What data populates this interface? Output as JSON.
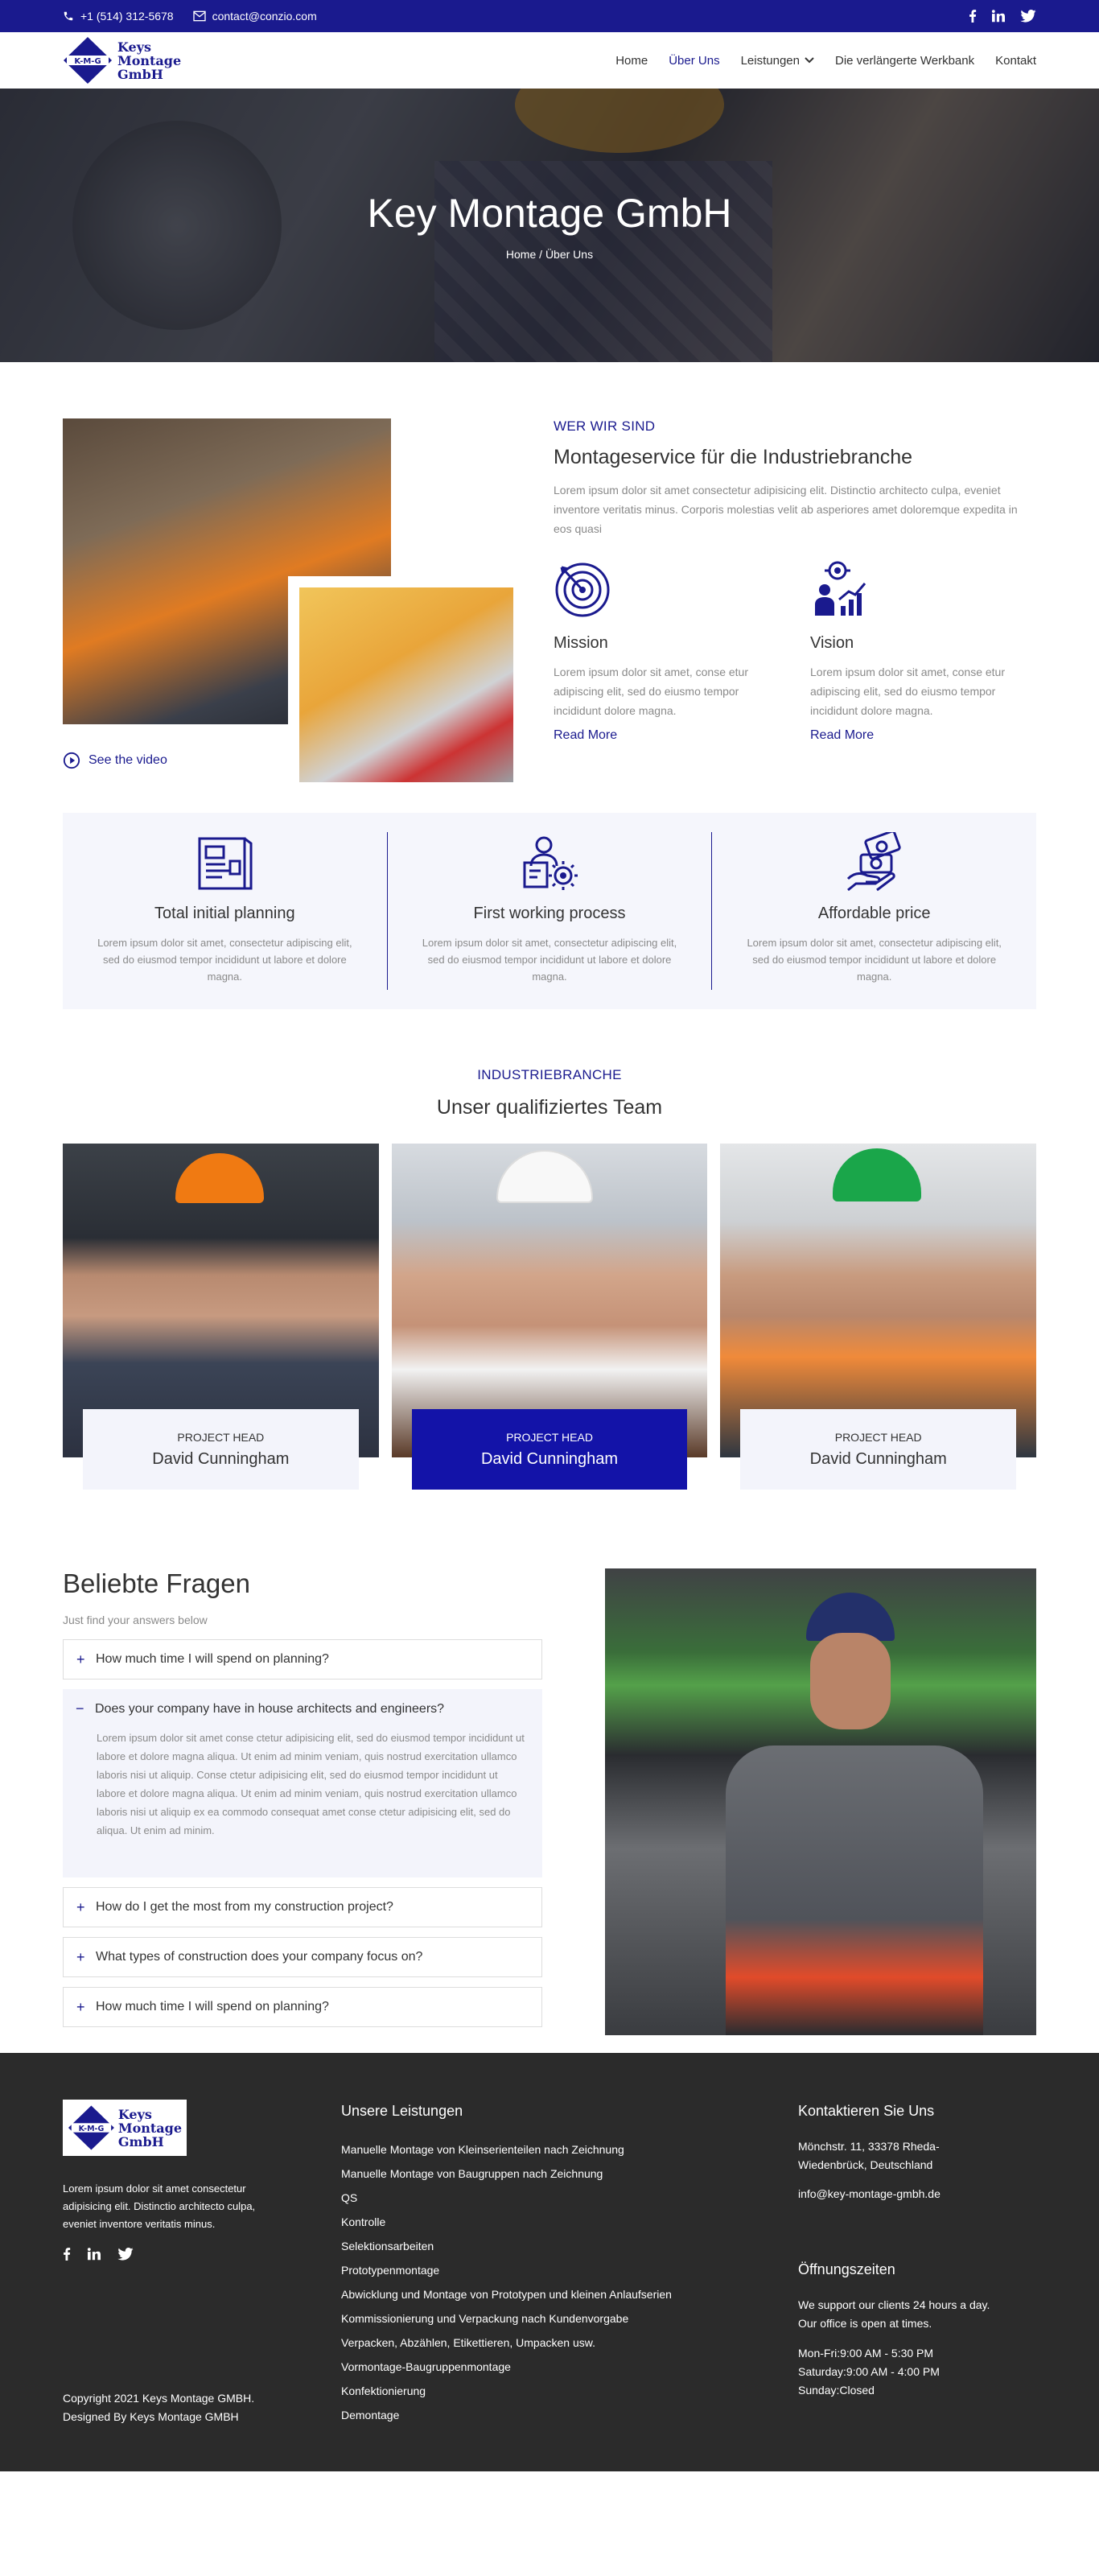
{
  "topbar": {
    "phone": "+1 (514) 312-5678",
    "email": "contact@conzio.com"
  },
  "brand": {
    "line1": "Keys",
    "line2": "Montage",
    "line3": "GmbH",
    "badge": "K-M-G"
  },
  "nav": {
    "home": "Home",
    "about": "Über Uns",
    "services": "Leistungen",
    "workbench": "Die verlängerte Werkbank",
    "contact": "Kontakt"
  },
  "hero": {
    "title": "Key Montage GmbH",
    "crumb_home": "Home",
    "crumb_sep": "/",
    "crumb_current": "Über Uns"
  },
  "about": {
    "video_label": "See the video",
    "eyebrow": "WER WIR SIND",
    "title": "Montageservice für die Industriebranche",
    "text": "Lorem ipsum dolor sit amet consectetur adipisicing elit. Distinctio architecto culpa, eveniet inventore veritatis minus. Corporis molestias velit ab asperiores amet doloremque expedita in eos quasi",
    "mission": {
      "title": "Mission",
      "text": "Lorem ipsum dolor sit amet, conse etur adipiscing elit, sed do eiusmo tempor incididunt dolore magna.",
      "link": "Read More"
    },
    "vision": {
      "title": "Vision",
      "text": "Lorem ipsum dolor sit amet, conse etur adipiscing elit, sed do eiusmo tempor incididunt dolore magna.",
      "link": "Read More"
    }
  },
  "features": [
    {
      "title": "Total initial planning",
      "text": "Lorem ipsum dolor sit amet, consectetur adipiscing elit, sed do eiusmod tempor incididunt ut labore et dolore magna."
    },
    {
      "title": "First working process",
      "text": "Lorem ipsum dolor sit amet, consectetur adipiscing elit, sed do eiusmod tempor incididunt ut labore et dolore magna."
    },
    {
      "title": "Affordable price",
      "text": "Lorem ipsum dolor sit amet, consectetur adipiscing elit, sed do eiusmod tempor incididunt ut labore et dolore magna."
    }
  ],
  "team": {
    "eyebrow": "INDUSTRIEBRANCHE",
    "title": "Unser qualifiziertes Team",
    "members": [
      {
        "role": "PROJECT HEAD",
        "name": "David Cunningham"
      },
      {
        "role": "PROJECT HEAD",
        "name": "David Cunningham"
      },
      {
        "role": "PROJECT HEAD",
        "name": "David Cunningham"
      }
    ]
  },
  "faq": {
    "title": "Beliebte Fragen",
    "subtitle": "Just find your answers below",
    "items": [
      {
        "q": "How much time I will spend on planning?",
        "sign": "+"
      },
      {
        "q": "Does your company have in house architects and engineers?",
        "sign": "−",
        "a": "Lorem ipsum dolor sit amet conse ctetur adipisicing elit, sed do eiusmod tempor incididunt ut labore et dolore magna aliqua. Ut enim ad minim veniam, quis nostrud exercitation ullamco laboris nisi ut aliquip. Conse ctetur adipisicing elit, sed do eiusmod tempor incididunt ut labore et dolore magna aliqua. Ut enim ad minim veniam, quis nostrud exercitation ullamco laboris nisi ut aliquip ex ea commodo consequat amet conse ctetur adipisicing elit, sed do aliqua. Ut enim ad minim."
      },
      {
        "q": "How do I get the most from my construction project?",
        "sign": "+"
      },
      {
        "q": "What types of construction does your company focus on?",
        "sign": "+"
      },
      {
        "q": "How much time I will spend on planning?",
        "sign": "+"
      }
    ]
  },
  "footer": {
    "about": "Lorem ipsum dolor sit amet consectetur adipisicing elit. Distinctio architecto culpa, eveniet inventore veritatis minus.",
    "copyright": "Copyright 2021 Keys Montage GMBH.",
    "designed": "Designed By Keys Montage GMBH",
    "services_title": "Unsere Leistungen",
    "services": [
      "Manuelle Montage von Kleinserienteilen nach Zeichnung",
      "Manuelle Montage von Baugruppen nach Zeichnung",
      "QS",
      "Kontrolle",
      "Selektionsarbeiten",
      "Prototypenmontage",
      "Abwicklung und Montage von Prototypen und kleinen Anlaufserien",
      "Kommissionierung und Verpackung nach Kundenvorgabe",
      "Verpacken, Abzählen, Etikettieren, Umpacken usw.",
      "Vormontage-Baugruppenmontage",
      "Konfektionierung",
      "Demontage"
    ],
    "contact_title": "Kontaktieren Sie Uns",
    "address1": "Mönchstr. 11, 33378 Rheda-",
    "address2": "Wiedenbrück, Deutschland",
    "email": "info@key-montage-gmbh.de",
    "hours_title": "Öffnungszeiten",
    "hours_text1": "We support our clients 24 hours a day.",
    "hours_text2": "Our office is open at times.",
    "hours": [
      "Mon-Fri:9:00 AM - 5:30 PM",
      "Saturday:9:00 AM - 4:00 PM",
      "Sunday:Closed"
    ]
  },
  "colors": {
    "brand": "#1a1a8e",
    "accent": "#1313a8",
    "footer_bg": "#2b2b2b",
    "feature_bg": "#f5f6fc"
  }
}
